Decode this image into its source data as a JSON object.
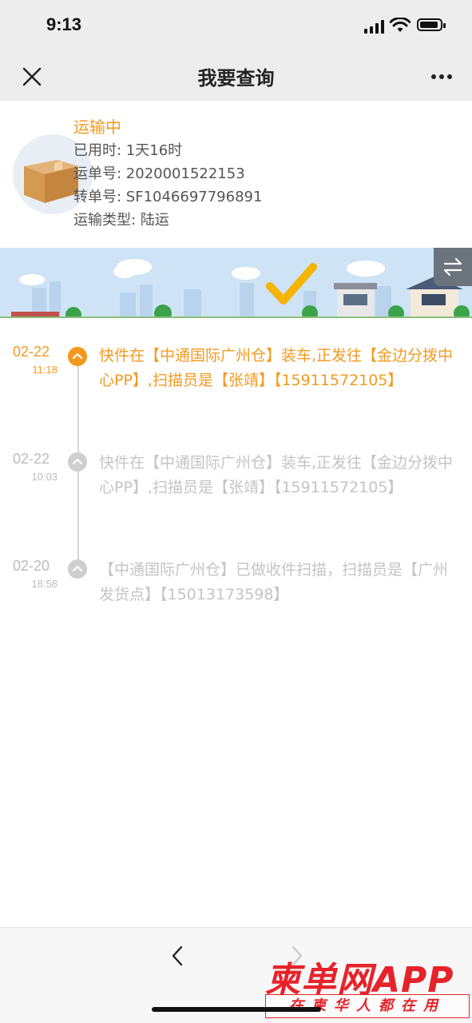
{
  "status_bar": {
    "time": "9:13"
  },
  "nav": {
    "title": "我要查询"
  },
  "package": {
    "status": "运输中",
    "lines": [
      "已用时: 1天16时",
      "运单号: 2020001522153",
      "转单号: SF1046697796891",
      "运输类型: 陆运"
    ]
  },
  "timeline": [
    {
      "date": "02-22",
      "time": "11:18",
      "text": "快件在【中通国际广州仓】装车,正发往【金边分拨中心PP】,扫描员是【张靖】【15911572105】",
      "active": true
    },
    {
      "date": "02-22",
      "time": "10:03",
      "text": "快件在【中通国际广州仓】装车,正发往【金边分拨中心PP】,扫描员是【张靖】【15911572105】",
      "active": false
    },
    {
      "date": "02-20",
      "time": "18:58",
      "text": "【中通国际广州仓】已做收件扫描，扫描员是【广州发货点】【15013173598】",
      "active": false
    }
  ],
  "colors": {
    "accent": "#f39a1e",
    "inactive": "#c4c4c4",
    "watermark": "#e6232a"
  },
  "watermark": {
    "brand": "柬单网APP",
    "slogan": "在柬华人都在用"
  }
}
